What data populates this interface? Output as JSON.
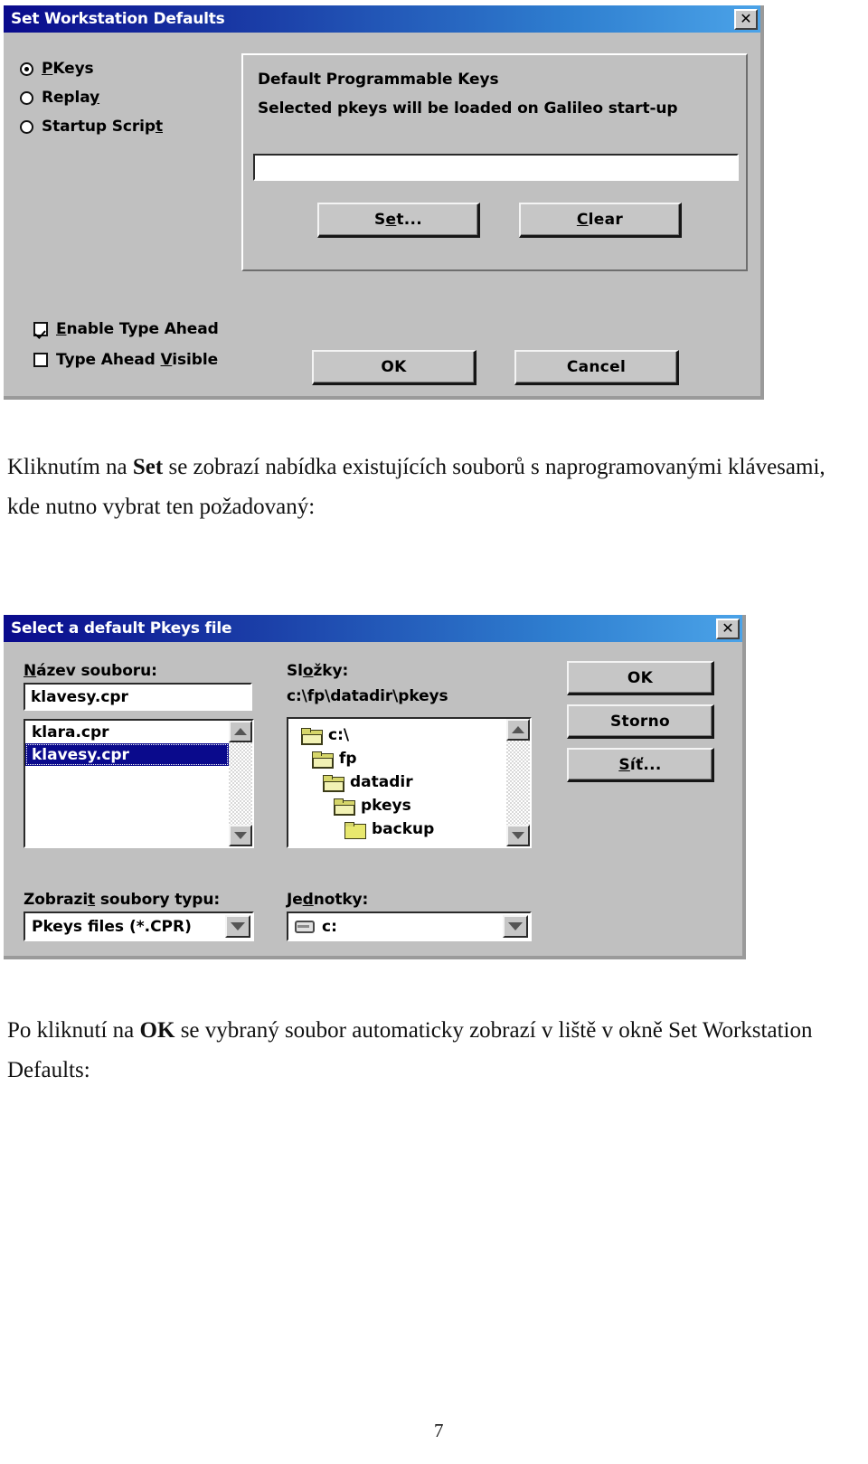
{
  "page": {
    "number": "7"
  },
  "dialog1": {
    "title": "Set Workstation Defaults",
    "close_label": "✕",
    "radios": [
      {
        "label_pre": "",
        "accel": "P",
        "label_post": "Keys",
        "checked": true
      },
      {
        "label_pre": "Repla",
        "accel": "y",
        "label_post": "",
        "checked": false
      },
      {
        "label_pre": "Startup Scrip",
        "accel": "t",
        "label_post": "",
        "checked": false
      }
    ],
    "group": {
      "heading": "Default Programmable Keys",
      "subheading": "Selected pkeys will be loaded on Galileo start-up",
      "textfield_value": "",
      "set_button": {
        "pre": "S",
        "accel": "e",
        "post": "t..."
      },
      "clear_button": {
        "pre": "",
        "accel": "C",
        "post": "lear"
      }
    },
    "checkboxes": [
      {
        "pre": "",
        "accel": "E",
        "post": "nable Type Ahead",
        "checked": true
      },
      {
        "pre": "Type Ahead ",
        "accel": "V",
        "post": "isible",
        "checked": false
      }
    ],
    "ok_label": "OK",
    "cancel_label": "Cancel"
  },
  "para1": {
    "part1": "Kliknutím na ",
    "bold1": "Set",
    "part2": " se zobrazí nabídka existujících souborů s naprogramovanými klávesami,",
    "line2": "kde nutno vybrat ten požadovaný:"
  },
  "dialog2": {
    "title": "Select a default Pkeys file",
    "close_label": "✕",
    "filename_label": {
      "accel": "N",
      "rest": "ázev souboru:"
    },
    "filename_value": "klavesy.cpr",
    "file_list": [
      {
        "name": "klara.cpr",
        "selected": false
      },
      {
        "name": "klavesy.cpr",
        "selected": true
      }
    ],
    "folders_label": {
      "pre": "Sl",
      "accel": "o",
      "post": "žky:"
    },
    "current_path": "c:\\fp\\datadir\\pkeys",
    "folder_tree": [
      {
        "name": "c:\\",
        "depth": 0,
        "open": true
      },
      {
        "name": "fp",
        "depth": 1,
        "open": true
      },
      {
        "name": "datadir",
        "depth": 2,
        "open": true
      },
      {
        "name": "pkeys",
        "depth": 3,
        "open": true
      },
      {
        "name": "backup",
        "depth": 4,
        "open": false
      }
    ],
    "buttons": [
      {
        "pre": "OK",
        "accel": "",
        "post": ""
      },
      {
        "pre": "Storno",
        "accel": "",
        "post": ""
      },
      {
        "pre": "",
        "accel": "S",
        "post": "íť..."
      }
    ],
    "filetype_label": {
      "pre": "Zobrazi",
      "accel": "t",
      "post": " soubory typu:"
    },
    "filetype_value": "Pkeys files (*.CPR)",
    "drives_label": {
      "pre": "Je",
      "accel": "d",
      "post": "notky:"
    },
    "drives_value": "c:"
  },
  "para2": {
    "part1": "Po kliknutí na ",
    "bold1": "OK",
    "part2": " se vybraný soubor automaticky zobrazí v liště v okně Set Workstation",
    "line2": "Defaults:"
  }
}
